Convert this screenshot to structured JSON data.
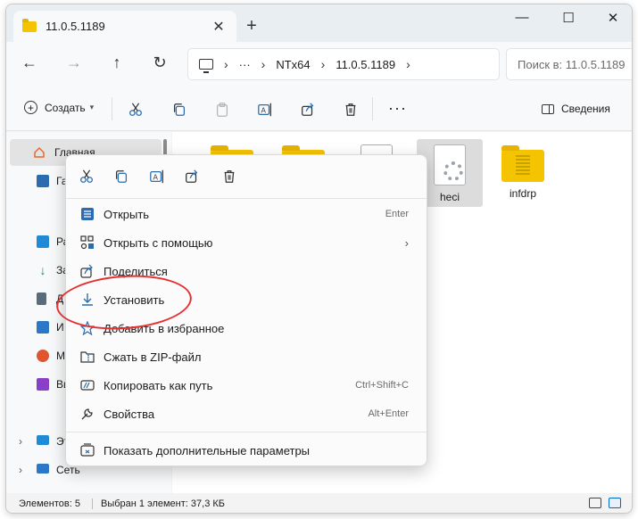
{
  "tab": {
    "title": "11.0.5.1189",
    "close": "✕",
    "new": "+"
  },
  "window_controls": {
    "minimize": "—",
    "maximize": "☐",
    "close": "✕"
  },
  "nav": {
    "back": "←",
    "forward": "→",
    "up": "↑",
    "refresh": "↻"
  },
  "address": {
    "segments": [
      "NTx64",
      "11.0.5.1189"
    ],
    "ellipsis": "···",
    "sep": "›"
  },
  "search": {
    "placeholder": "Поиск в: 11.0.5.1189"
  },
  "commandbar": {
    "create_label": "Создать",
    "more": "···",
    "details_label": "Сведения"
  },
  "sidebar": {
    "items": [
      {
        "label": "Главная",
        "icon": "home-icon",
        "color": "#e46a2e"
      },
      {
        "label": "Га",
        "icon": "gallery-icon",
        "color": "#2b6cb0"
      },
      {
        "label": "Ра",
        "icon": "desktop-icon",
        "color": "#1f8bd6"
      },
      {
        "label": "За",
        "icon": "download-icon",
        "color": "#1e8e5a"
      },
      {
        "label": "Д",
        "icon": "documents-icon",
        "color": "#5a6b7b"
      },
      {
        "label": "И",
        "icon": "pictures-icon",
        "color": "#2b78c8"
      },
      {
        "label": "М",
        "icon": "music-icon",
        "color": "#e0552f"
      },
      {
        "label": "Ви",
        "icon": "video-icon",
        "color": "#8a3fc8"
      },
      {
        "label": "Эт",
        "icon": "this-pc-icon",
        "color": "#1f8bd6"
      },
      {
        "label": "Сеть",
        "icon": "network-icon",
        "color": "#2b78c8"
      }
    ]
  },
  "files": [
    {
      "name": "",
      "type": "folder"
    },
    {
      "name": "",
      "type": "folder"
    },
    {
      "name": "",
      "type": "document"
    },
    {
      "name": "heci",
      "type": "setup-file"
    },
    {
      "name": "infdrp",
      "type": "zip-folder"
    }
  ],
  "context_menu": {
    "items": [
      {
        "label": "Открыть",
        "shortcut": "Enter",
        "icon": "open-icon"
      },
      {
        "label": "Открыть с помощью",
        "shortcut": "",
        "icon": "open-with-icon",
        "submenu": "›"
      },
      {
        "label": "Поделиться",
        "shortcut": "",
        "icon": "share-icon"
      },
      {
        "label": "Установить",
        "shortcut": "",
        "icon": "install-icon"
      },
      {
        "label": "Добавить в избранное",
        "shortcut": "",
        "icon": "star-icon"
      },
      {
        "label": "Сжать в ZIP-файл",
        "shortcut": "",
        "icon": "zip-icon"
      },
      {
        "label": "Копировать как путь",
        "shortcut": "Ctrl+Shift+C",
        "icon": "copy-path-icon"
      },
      {
        "label": "Свойства",
        "shortcut": "Alt+Enter",
        "icon": "wrench-icon"
      },
      {
        "label": "Показать дополнительные параметры",
        "shortcut": "",
        "icon": "more-options-icon"
      }
    ]
  },
  "status": {
    "items_count": "Элементов: 5",
    "selected": "Выбран 1 элемент: 37,3 КБ"
  },
  "colors": {
    "accent": "#0067c0",
    "folder": "#f5c400",
    "highlight_ellipse": "#e53030"
  }
}
